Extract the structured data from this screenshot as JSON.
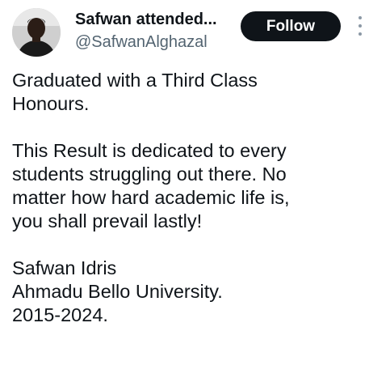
{
  "header": {
    "display_name": "Safwan attended...",
    "handle": "@SafwanAlghazal",
    "follow_label": "Follow"
  },
  "tweet": {
    "paragraph_1": [
      "Graduated with a Third Class",
      "Honours."
    ],
    "paragraph_2": [
      "This Result is dedicated to every",
      "students struggling out there. No",
      "matter how hard academic life is,",
      "you shall prevail lastly!"
    ],
    "paragraph_3": [
      "Safwan Idris",
      "Ahmadu Bello University.",
      "2015-2024."
    ]
  },
  "icons": {
    "avatar": "profile-photo",
    "more": "more-vertical-icon"
  },
  "colors": {
    "follow_bg": "#0f1419",
    "follow_text": "#ffffff",
    "handle": "#536471",
    "text": "#0f1419"
  }
}
